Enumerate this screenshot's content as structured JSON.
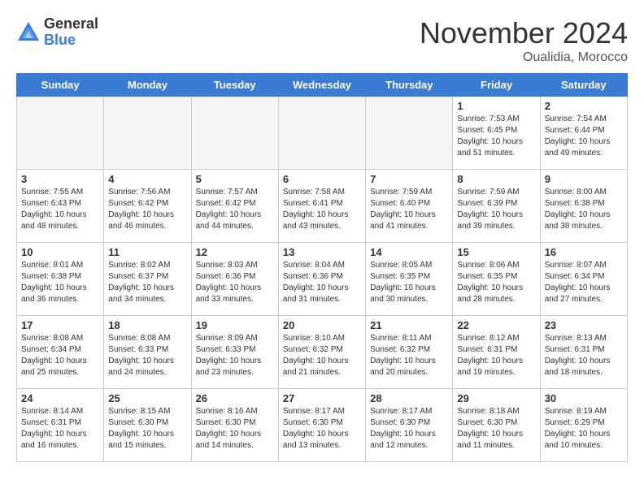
{
  "header": {
    "logo_general": "General",
    "logo_blue": "Blue",
    "month_title": "November 2024",
    "location": "Oualidia, Morocco"
  },
  "weekdays": [
    "Sunday",
    "Monday",
    "Tuesday",
    "Wednesday",
    "Thursday",
    "Friday",
    "Saturday"
  ],
  "weeks": [
    [
      {
        "day": "",
        "empty": true
      },
      {
        "day": "",
        "empty": true
      },
      {
        "day": "",
        "empty": true
      },
      {
        "day": "",
        "empty": true
      },
      {
        "day": "",
        "empty": true
      },
      {
        "day": "1",
        "sunrise": "Sunrise: 7:53 AM",
        "sunset": "Sunset: 6:45 PM",
        "daylight": "Daylight: 10 hours and 51 minutes."
      },
      {
        "day": "2",
        "sunrise": "Sunrise: 7:54 AM",
        "sunset": "Sunset: 6:44 PM",
        "daylight": "Daylight: 10 hours and 49 minutes."
      }
    ],
    [
      {
        "day": "3",
        "sunrise": "Sunrise: 7:55 AM",
        "sunset": "Sunset: 6:43 PM",
        "daylight": "Daylight: 10 hours and 48 minutes."
      },
      {
        "day": "4",
        "sunrise": "Sunrise: 7:56 AM",
        "sunset": "Sunset: 6:42 PM",
        "daylight": "Daylight: 10 hours and 46 minutes."
      },
      {
        "day": "5",
        "sunrise": "Sunrise: 7:57 AM",
        "sunset": "Sunset: 6:42 PM",
        "daylight": "Daylight: 10 hours and 44 minutes."
      },
      {
        "day": "6",
        "sunrise": "Sunrise: 7:58 AM",
        "sunset": "Sunset: 6:41 PM",
        "daylight": "Daylight: 10 hours and 43 minutes."
      },
      {
        "day": "7",
        "sunrise": "Sunrise: 7:59 AM",
        "sunset": "Sunset: 6:40 PM",
        "daylight": "Daylight: 10 hours and 41 minutes."
      },
      {
        "day": "8",
        "sunrise": "Sunrise: 7:59 AM",
        "sunset": "Sunset: 6:39 PM",
        "daylight": "Daylight: 10 hours and 39 minutes."
      },
      {
        "day": "9",
        "sunrise": "Sunrise: 8:00 AM",
        "sunset": "Sunset: 6:38 PM",
        "daylight": "Daylight: 10 hours and 38 minutes."
      }
    ],
    [
      {
        "day": "10",
        "sunrise": "Sunrise: 8:01 AM",
        "sunset": "Sunset: 6:38 PM",
        "daylight": "Daylight: 10 hours and 36 minutes."
      },
      {
        "day": "11",
        "sunrise": "Sunrise: 8:02 AM",
        "sunset": "Sunset: 6:37 PM",
        "daylight": "Daylight: 10 hours and 34 minutes."
      },
      {
        "day": "12",
        "sunrise": "Sunrise: 8:03 AM",
        "sunset": "Sunset: 6:36 PM",
        "daylight": "Daylight: 10 hours and 33 minutes."
      },
      {
        "day": "13",
        "sunrise": "Sunrise: 8:04 AM",
        "sunset": "Sunset: 6:36 PM",
        "daylight": "Daylight: 10 hours and 31 minutes."
      },
      {
        "day": "14",
        "sunrise": "Sunrise: 8:05 AM",
        "sunset": "Sunset: 6:35 PM",
        "daylight": "Daylight: 10 hours and 30 minutes."
      },
      {
        "day": "15",
        "sunrise": "Sunrise: 8:06 AM",
        "sunset": "Sunset: 6:35 PM",
        "daylight": "Daylight: 10 hours and 28 minutes."
      },
      {
        "day": "16",
        "sunrise": "Sunrise: 8:07 AM",
        "sunset": "Sunset: 6:34 PM",
        "daylight": "Daylight: 10 hours and 27 minutes."
      }
    ],
    [
      {
        "day": "17",
        "sunrise": "Sunrise: 8:08 AM",
        "sunset": "Sunset: 6:34 PM",
        "daylight": "Daylight: 10 hours and 25 minutes."
      },
      {
        "day": "18",
        "sunrise": "Sunrise: 8:08 AM",
        "sunset": "Sunset: 6:33 PM",
        "daylight": "Daylight: 10 hours and 24 minutes."
      },
      {
        "day": "19",
        "sunrise": "Sunrise: 8:09 AM",
        "sunset": "Sunset: 6:33 PM",
        "daylight": "Daylight: 10 hours and 23 minutes."
      },
      {
        "day": "20",
        "sunrise": "Sunrise: 8:10 AM",
        "sunset": "Sunset: 6:32 PM",
        "daylight": "Daylight: 10 hours and 21 minutes."
      },
      {
        "day": "21",
        "sunrise": "Sunrise: 8:11 AM",
        "sunset": "Sunset: 6:32 PM",
        "daylight": "Daylight: 10 hours and 20 minutes."
      },
      {
        "day": "22",
        "sunrise": "Sunrise: 8:12 AM",
        "sunset": "Sunset: 6:31 PM",
        "daylight": "Daylight: 10 hours and 19 minutes."
      },
      {
        "day": "23",
        "sunrise": "Sunrise: 8:13 AM",
        "sunset": "Sunset: 6:31 PM",
        "daylight": "Daylight: 10 hours and 18 minutes."
      }
    ],
    [
      {
        "day": "24",
        "sunrise": "Sunrise: 8:14 AM",
        "sunset": "Sunset: 6:31 PM",
        "daylight": "Daylight: 10 hours and 16 minutes."
      },
      {
        "day": "25",
        "sunrise": "Sunrise: 8:15 AM",
        "sunset": "Sunset: 6:30 PM",
        "daylight": "Daylight: 10 hours and 15 minutes."
      },
      {
        "day": "26",
        "sunrise": "Sunrise: 8:16 AM",
        "sunset": "Sunset: 6:30 PM",
        "daylight": "Daylight: 10 hours and 14 minutes."
      },
      {
        "day": "27",
        "sunrise": "Sunrise: 8:17 AM",
        "sunset": "Sunset: 6:30 PM",
        "daylight": "Daylight: 10 hours and 13 minutes."
      },
      {
        "day": "28",
        "sunrise": "Sunrise: 8:17 AM",
        "sunset": "Sunset: 6:30 PM",
        "daylight": "Daylight: 10 hours and 12 minutes."
      },
      {
        "day": "29",
        "sunrise": "Sunrise: 8:18 AM",
        "sunset": "Sunset: 6:30 PM",
        "daylight": "Daylight: 10 hours and 11 minutes."
      },
      {
        "day": "30",
        "sunrise": "Sunrise: 8:19 AM",
        "sunset": "Sunset: 6:29 PM",
        "daylight": "Daylight: 10 hours and 10 minutes."
      }
    ]
  ]
}
